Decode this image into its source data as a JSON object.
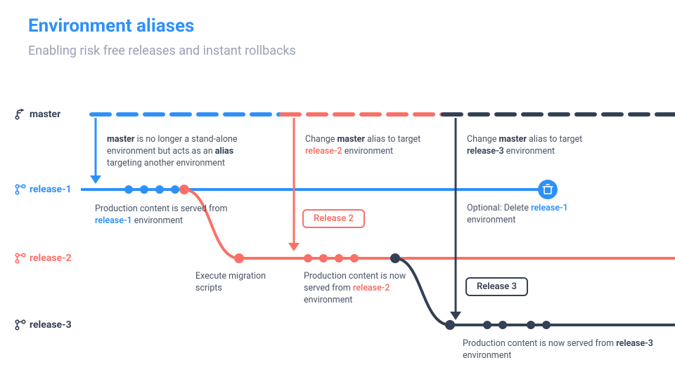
{
  "title": "Environment aliases",
  "subtitle": "Enabling risk free releases and instant rollbacks",
  "rows": {
    "master": "master",
    "r1": "release-1",
    "r2": "release-2",
    "r3": "release-3"
  },
  "captions": {
    "c1a": "master",
    "c1b": " is no longer a stand-alone environment but acts as an ",
    "c1c": "alias",
    "c1d": " targeting another environment",
    "c2a": "Production content is served from ",
    "c2b": "release-1",
    "c2c": " environment",
    "c3a": "Change ",
    "c3b": "master",
    "c3c": " alias to target ",
    "c3d": "release-2",
    "c3e": " environment",
    "c4": "Execute migration scripts",
    "c5a": "Production content is now served from ",
    "c5b": "release-2",
    "c5c": " environment",
    "c6a": "Change ",
    "c6b": "master",
    "c6c": " alias to target ",
    "c6d": "release-3",
    "c6e": " environment",
    "c7a": "Optional: Delete ",
    "c7b": "release-1",
    "c7c": " environment",
    "c8a": "Production content is now served from ",
    "c8b": "release-3",
    "c8c": " environment"
  },
  "tags": {
    "rel2": "Release 2",
    "rel3": "Release 3"
  },
  "colors": {
    "blue": "#2e90fa",
    "orange": "#f97066",
    "dark": "#344054"
  }
}
